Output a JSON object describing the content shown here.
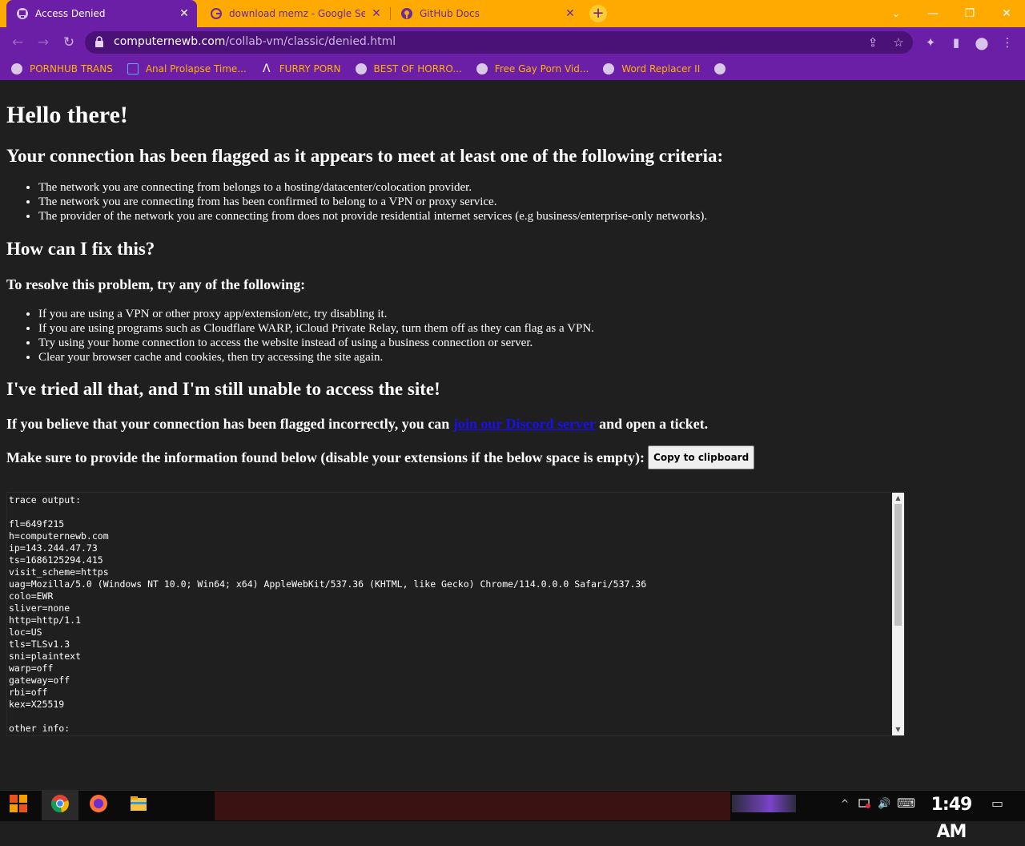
{
  "browser": {
    "tabs": [
      {
        "title": "Access Denied",
        "active": true,
        "icon": "collab-vm-icon"
      },
      {
        "title": "download memz - Google Search",
        "active": false,
        "icon": "google-icon"
      },
      {
        "title": "GitHub Docs",
        "active": false,
        "icon": "github-icon"
      }
    ],
    "new_tab": "+",
    "window_controls": {
      "chevron": "⌄",
      "minimize": "—",
      "maximize": "❐",
      "close": "✕"
    },
    "tab_close": "✕",
    "url": {
      "host": "computernewb.com",
      "path": "/collab-vm/classic/denied.html"
    },
    "nav": {
      "back": "←",
      "forward": "→",
      "reload": "↻"
    },
    "toolbar_icons": {
      "share": "⇪",
      "star": "☆",
      "extensions": "✦",
      "sidepanel": "▮",
      "profile": "●",
      "menu": "⋮"
    },
    "bookmarks": [
      {
        "label": "PORNHUB TRANS",
        "icon": "globe-icon"
      },
      {
        "label": "Anal Prolapse Time...",
        "icon": "site-icon"
      },
      {
        "label": "FURRY PORN",
        "icon": "a-logo-icon"
      },
      {
        "label": "BEST OF HORRO...",
        "icon": "globe-icon"
      },
      {
        "label": "Free Gay Porn Vid...",
        "icon": "collab-vm-icon"
      },
      {
        "label": "Word Replacer II",
        "icon": "globe-icon"
      },
      {
        "label": "",
        "icon": "chrome-icon"
      }
    ]
  },
  "page": {
    "title": "Hello there!",
    "flag_heading": "Your connection has been flagged as it appears to meet at least one of the following criteria:",
    "criteria": [
      "The network you are connecting from belongs to a hosting/datacenter/colocation provider.",
      "The network you are connecting from has been confirmed to belong to a VPN or proxy service.",
      "The provider of the network you are connecting from does not provide residential internet services (e.g business/enterprise-only networks)."
    ],
    "fix_heading": "How can I fix this?",
    "resolve_heading": "To resolve this problem, try any of the following:",
    "fixes": [
      "If you are using a VPN or other proxy app/extension/etc, try disabling it.",
      "If you are using programs such as Cloudflare WARP, iCloud Private Relay, turn them off as they can flag as a VPN.",
      "Try using your home connection to access the website instead of using a business connection or server.",
      "Clear your browser cache and cookies, then try accessing the site again."
    ],
    "tried_heading": "I've tried all that, and I'm still unable to access the site!",
    "incorrect_prefix": "If you believe that your connection has been flagged incorrectly, you can ",
    "discord_link": "join our Discord server",
    "incorrect_suffix": " and open a ticket.",
    "provide_text": "Make sure to provide the information found below (disable your extensions if the below space is empty):",
    "copy_button": "Copy to clipboard",
    "trace": "trace output:\n\nfl=649f215\nh=computernewb.com\nip=143.244.47.73\nts=1686125294.415\nvisit_scheme=https\nuag=Mozilla/5.0 (Windows NT 10.0; Win64; x64) AppleWebKit/537.36 (KHTML, like Gecko) Chrome/114.0.0.0 Safari/537.36\ncolo=EWR\nsliver=none\nhttp=http/1.1\nloc=US\ntls=TLSv1.3\nsni=plaintext\nwarp=off\ngateway=off\nrbi=off\nkex=X25519\n\nother info:"
  },
  "taskbar": {
    "clock": "1:49 AM",
    "apps": [
      "start-icon",
      "chrome-icon",
      "firefox-icon",
      "file-explorer-icon"
    ],
    "tray": {
      "chevron": "^",
      "volume": "🔊",
      "keyboard": "⌨",
      "notifications": "▭"
    }
  },
  "colors": {
    "tab_bar": "#ffaa00",
    "toolbar": "#6b1fa6",
    "bookmark_text": "#ffb300",
    "page_bg": "#1f1f1f",
    "link": "#1a0dee"
  }
}
